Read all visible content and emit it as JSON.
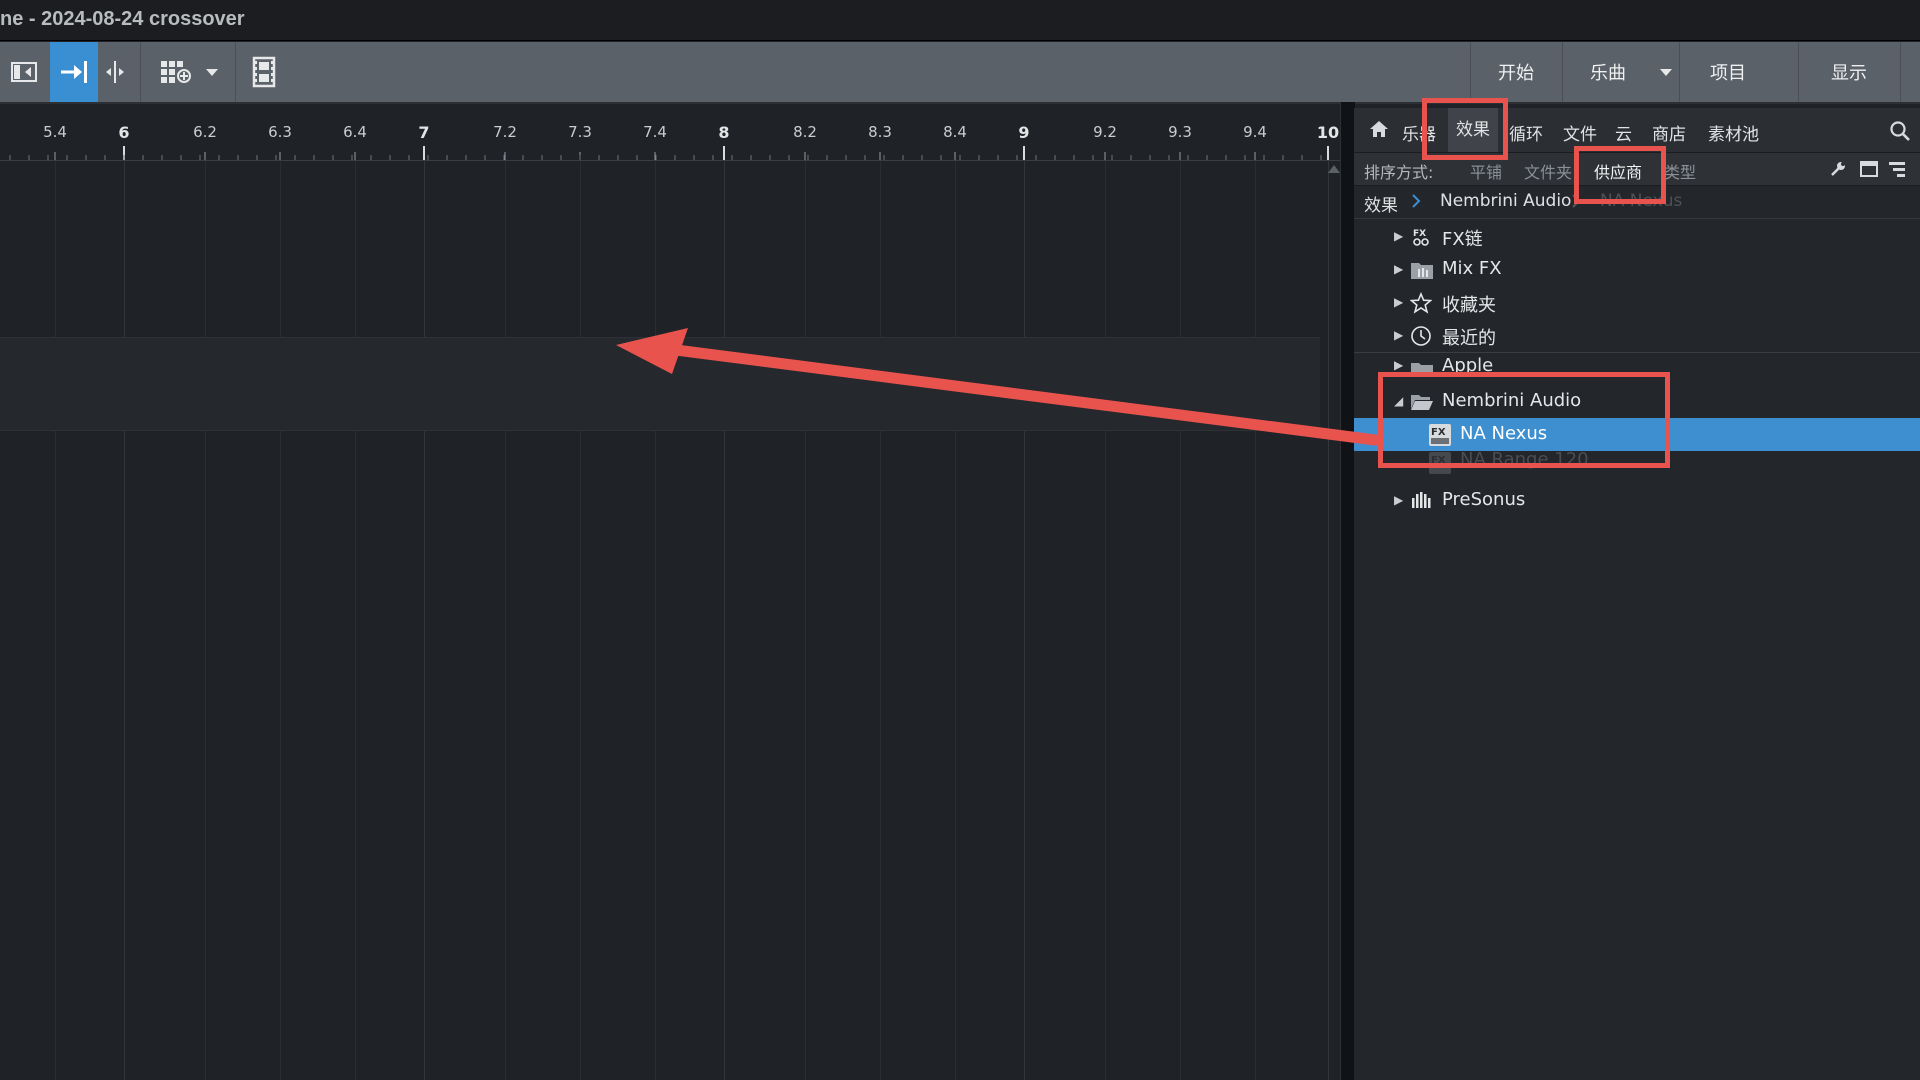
{
  "window": {
    "title": "ne - 2024-08-24 crossover"
  },
  "toolbar": {
    "tools": [
      "inspector-toggle-icon",
      "snap-right-icon",
      "split-icon",
      "grid-add-icon",
      "dropdown-icon",
      "film-icon"
    ],
    "nav": {
      "start": "开始",
      "song": "乐曲",
      "project": "项目",
      "display": "显示"
    }
  },
  "ruler": {
    "ticks": [
      "5.4",
      "6",
      "6.2",
      "6.3",
      "6.4",
      "7",
      "7.2",
      "7.3",
      "7.4",
      "8",
      "8.2",
      "8.3",
      "8.4",
      "9",
      "9.2",
      "9.3",
      "9.4",
      "10"
    ]
  },
  "browser": {
    "tabs": {
      "instruments": "乐器",
      "effects": "效果",
      "loops": "循环",
      "files": "文件",
      "cloud": "云",
      "shop": "商店",
      "pool": "素材池"
    },
    "sort": {
      "label": "排序方式:",
      "flat": "平铺",
      "folder": "文件夹",
      "vendor": "供应商",
      "type": "类型"
    },
    "breadcrumb": {
      "root": "效果",
      "vendor": "Nembrini Audio",
      "item": "NA Nexus"
    },
    "tree": {
      "fxchain": "FX链",
      "mixfx": "Mix FX",
      "favorites": "收藏夹",
      "recent": "最近的",
      "apple": "Apple",
      "nembrini": "Nembrini Audio",
      "nexus": "NA Nexus",
      "range": "NA Range 120",
      "presonus": "PreSonus"
    },
    "fx_badge": "FX"
  },
  "colors": {
    "accent": "#3a8fd2",
    "highlight": "#e8534d",
    "panel": "#23262a",
    "toolbar": "#5b6168"
  }
}
